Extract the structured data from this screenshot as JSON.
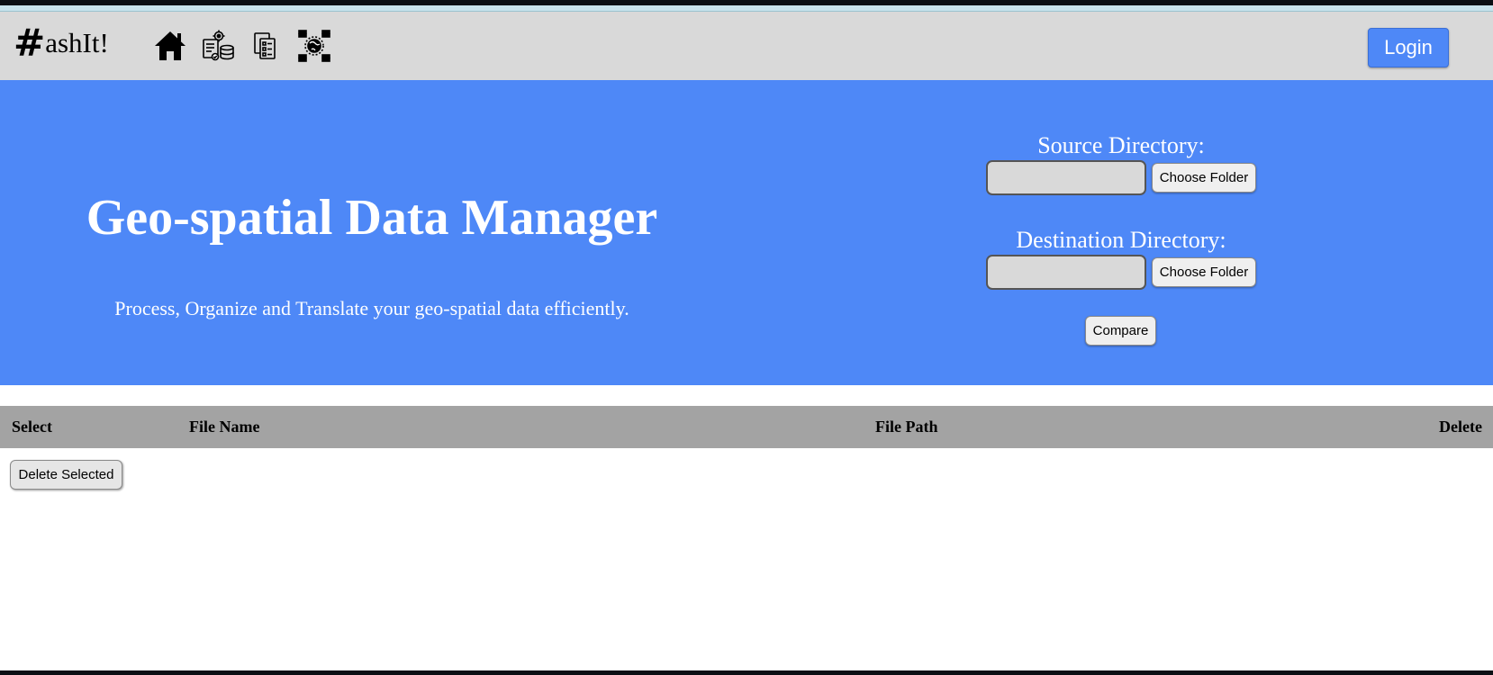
{
  "navbar": {
    "logo_hash": "#",
    "logo_text": "ashIt!",
    "icons": [
      "home-icon",
      "data-settings-icon",
      "documents-icon",
      "geo-network-icon"
    ],
    "login_label": "Login"
  },
  "hero": {
    "title": "Geo-spatial Data Manager",
    "subtitle": "Process, Organize and Translate your geo-spatial data efficiently.",
    "source_label": "Source Directory:",
    "source_value": "",
    "destination_label": "Destination Directory:",
    "destination_value": "",
    "choose_folder_label": "Choose Folder",
    "compare_label": "Compare"
  },
  "table": {
    "columns": [
      "Select",
      "File Name",
      "File Path",
      "Delete"
    ],
    "rows": []
  },
  "actions": {
    "delete_selected_label": "Delete Selected"
  },
  "colors": {
    "accent": "#4e88f7",
    "navbar_bg": "#d9d9d9",
    "table_header_bg": "#a3a3a3"
  }
}
